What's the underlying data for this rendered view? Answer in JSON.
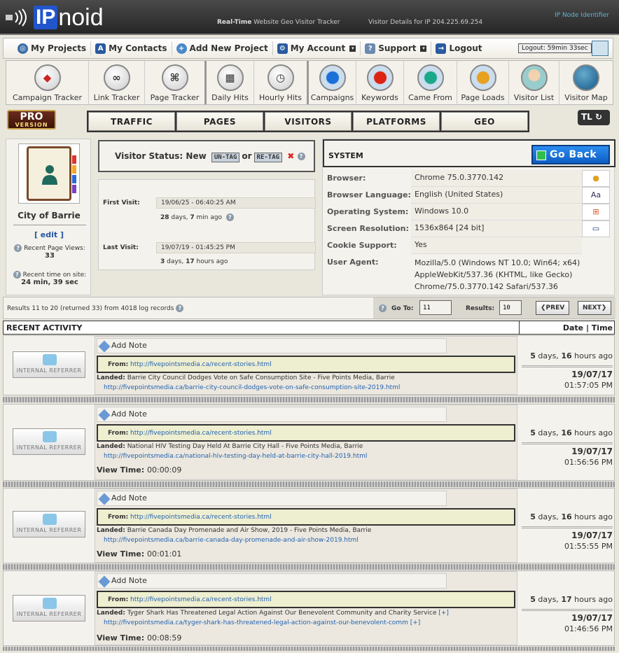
{
  "header": {
    "logo_ip": "IP",
    "logo_noid": "noid",
    "tagline_bold": "Real-Time",
    "tagline_rest": " Website Geo Visitor Tracker",
    "visitor_details": "Visitor Details for IP 204.225.69.254",
    "node_identifier": "IP Node Identifier"
  },
  "nav": {
    "items": [
      {
        "label": "My Projects"
      },
      {
        "label": "My Contacts"
      },
      {
        "label": "Add New Project"
      },
      {
        "label": "My Account"
      },
      {
        "label": "Support"
      },
      {
        "label": "Logout"
      }
    ],
    "logout_timer": "Logout: 59min 33sec"
  },
  "toolbar": {
    "items": [
      {
        "label": "Campaign Tracker"
      },
      {
        "label": "Link Tracker"
      },
      {
        "label": "Page Tracker"
      },
      {
        "label": "Daily Hits"
      },
      {
        "label": "Hourly Hits"
      },
      {
        "label": "Campaigns"
      },
      {
        "label": "Keywords"
      },
      {
        "label": "Came From"
      },
      {
        "label": "Page Loads"
      },
      {
        "label": "Visitor List"
      },
      {
        "label": "Visitor Map"
      }
    ]
  },
  "pro_badge": {
    "line1": "PRO",
    "line2": "VERSION"
  },
  "tabs": [
    {
      "label": "TRAFFIC"
    },
    {
      "label": "PAGES"
    },
    {
      "label": "VISITORS"
    },
    {
      "label": "PLATFORMS"
    },
    {
      "label": "GEO"
    }
  ],
  "tl_badge": "TL",
  "profile": {
    "name": "City of Barrie",
    "edit": "[ edit ]",
    "page_views_label": "Recent Page Views:",
    "page_views": "33",
    "time_label": "Recent time on site:",
    "time_value": "24 min, 39 sec"
  },
  "status": {
    "label": "Visitor Status: New",
    "untag": "UN-TAG",
    "or": "or",
    "retag": "RE-TAG"
  },
  "visits": {
    "first_label": "First Visit:",
    "first_date": "19/06/25 - 06:40:25 AM",
    "first_ago_days": "28",
    "first_ago_mins": "7",
    "last_label": "Last Visit:",
    "last_date": "19/07/19 - 01:45:25 PM",
    "last_ago_days": "3",
    "last_ago_hours": "17"
  },
  "system": {
    "title": "SYSTEM",
    "go_back": "Go Back",
    "rows": [
      {
        "key": "Browser:",
        "value": "Chrome 75.0.3770.142",
        "icon": "chrome-icon"
      },
      {
        "key": "Browser Language:",
        "value": "English (United States)",
        "icon": "language-icon"
      },
      {
        "key": "Operating System:",
        "value": "Windows 10.0",
        "icon": "windows-icon"
      },
      {
        "key": "Screen Resolution:",
        "value": "1536x864 [24 bit]",
        "icon": "monitor-icon"
      },
      {
        "key": "Cookie Support:",
        "value": "Yes",
        "icon": ""
      }
    ],
    "ua_key": "User Agent:",
    "ua_value": "Mozilla/5.0 (Windows NT 10.0; Win64; x64) AppleWebKit/537.36 (KHTML, like Gecko) Chrome/75.0.3770.142 Safari/537.36"
  },
  "results": {
    "text": "Results 11 to 20 (returned 33) from 4018 log records",
    "goto_label": "Go To:",
    "goto_value": "11",
    "results_label": "Results:",
    "results_value": "10",
    "prev": "PREV",
    "next": "NEXT"
  },
  "activity": {
    "title": "RECENT ACTIVITY",
    "date_time": "Date | Time",
    "add_note": "Add Note",
    "from_label": "From:",
    "landed_label": "Landed:",
    "view_time_label": "View Time:",
    "referrer": "INTERNAL REFERRER",
    "entries": [
      {
        "from": "http://fivepointsmedia.ca/recent-stories.html",
        "landed_title": "Barrie City Council Dodges Vote on Safe Consumption Site - Five Points Media, Barrie",
        "landed_url": "http://fivepointsmedia.ca/barrie-city-council-dodges-vote-on-safe-consumption-site-2019.html",
        "view_time": "",
        "ago_days": "5",
        "ago_hours": "16",
        "date": "19/07/17",
        "time": "01:57:05 PM"
      },
      {
        "from": "http://fivepointsmedia.ca/recent-stories.html",
        "landed_title": "National HIV Testing Day Held At Barrie City Hall - Five Points Media, Barrie",
        "landed_url": "http://fivepointsmedia.ca/national-hiv-testing-day-held-at-barrie-city-hall-2019.html",
        "view_time": "00:00:09",
        "ago_days": "5",
        "ago_hours": "16",
        "date": "19/07/17",
        "time": "01:56:56 PM"
      },
      {
        "from": "http://fivepointsmedia.ca/recent-stories.html",
        "landed_title": "Barrie Canada Day Promenade and Air Show, 2019 - Five Points Media, Barrie",
        "landed_url": "http://fivepointsmedia.ca/barrie-canada-day-promenade-and-air-show-2019.html",
        "view_time": "00:01:01",
        "ago_days": "5",
        "ago_hours": "16",
        "date": "19/07/17",
        "time": "01:55:55 PM"
      },
      {
        "from": "http://fivepointsmedia.ca/recent-stories.html",
        "landed_title": "Tyger Shark Has Threatened Legal Action Against Our Benevolent Community and Charity Service",
        "landed_url": "http://fivepointsmedia.ca/tyger-shark-has-threatened-legal-action-against-our-benevolent-comm",
        "view_time": "00:08:59",
        "ago_days": "5",
        "ago_hours": "17",
        "date": "19/07/17",
        "time": "01:46:56 PM"
      }
    ]
  }
}
